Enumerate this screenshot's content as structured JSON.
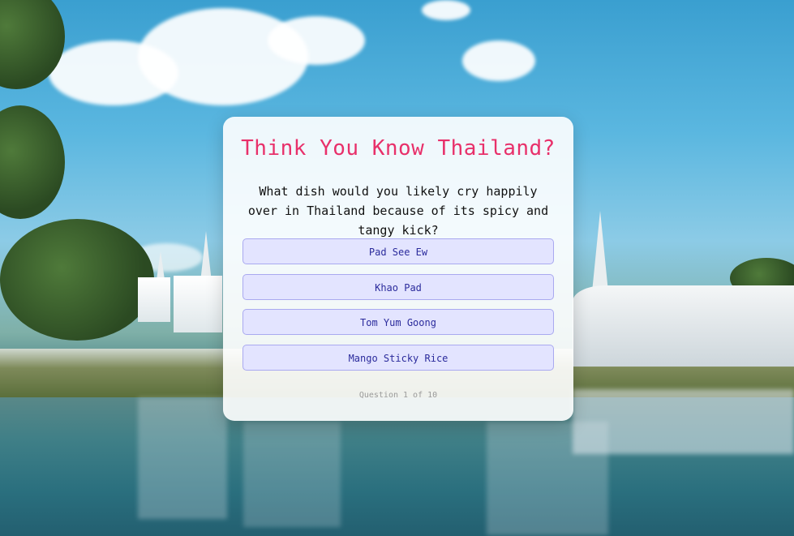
{
  "quiz": {
    "title": "Think You Know Thailand?",
    "question": "What dish would you likely cry happily over in Thailand because of its spicy and tangy kick?",
    "options": [
      {
        "label": "Pad See Ew"
      },
      {
        "label": "Khao Pad"
      },
      {
        "label": "Tom Yum Goong"
      },
      {
        "label": "Mango Sticky Rice"
      }
    ],
    "progress": "Question 1 of 10"
  },
  "background": {
    "scene": "White Temple (Wat Rong Khun) reflected in pond under blue sky"
  },
  "colors": {
    "title": "#e8306a",
    "option_bg": "#e3e4ff",
    "option_border": "#a9a9f0",
    "option_text": "#2b2b9c"
  }
}
